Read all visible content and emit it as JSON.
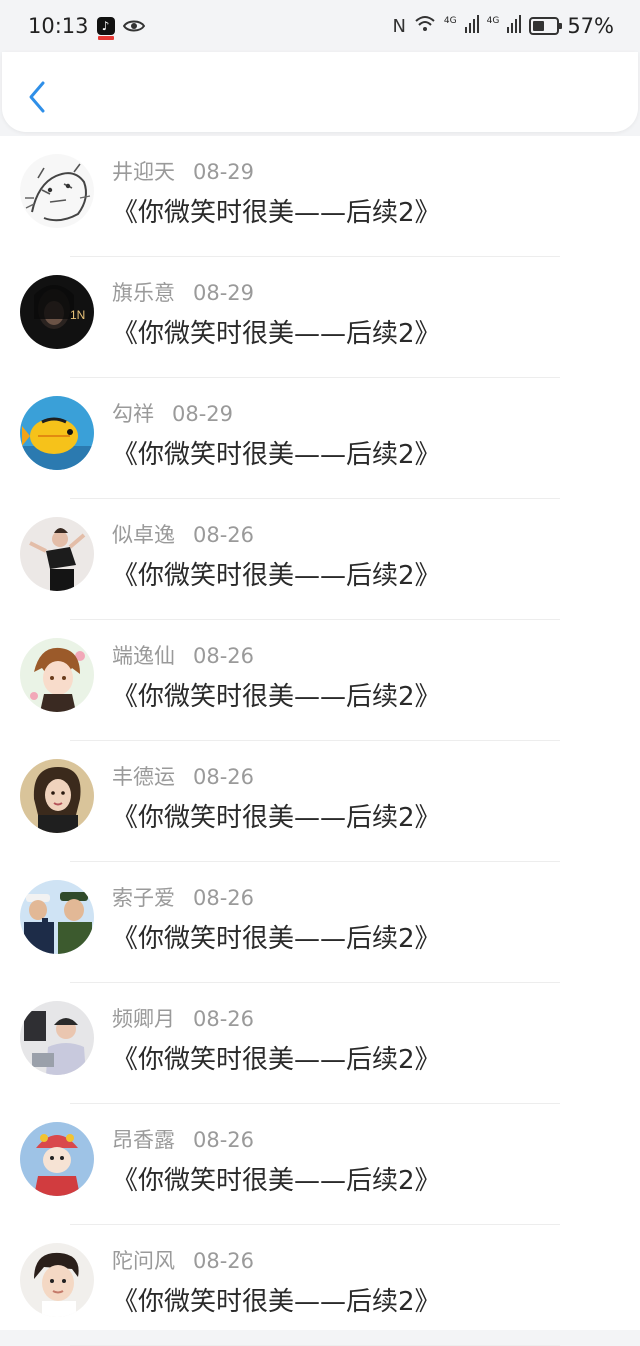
{
  "status_bar": {
    "time": "10:13",
    "nfc": "N",
    "network_a": "4G",
    "network_b": "4G",
    "battery_percent": "57%",
    "battery_level": 0.57
  },
  "colors": {
    "accent": "#2f8fe8",
    "meta_text": "#9a9a9a",
    "title_text": "#2a2a2a"
  },
  "nav": {
    "back_icon": "chevron-left-icon"
  },
  "comments": [
    {
      "name": "井迎天",
      "date": "08-29",
      "title": "《你微笑时很美——后续2》"
    },
    {
      "name": "旗乐意",
      "date": "08-29",
      "title": "《你微笑时很美——后续2》"
    },
    {
      "name": "勾祥",
      "date": "08-29",
      "title": "《你微笑时很美——后续2》"
    },
    {
      "name": "似卓逸",
      "date": "08-26",
      "title": "《你微笑时很美——后续2》"
    },
    {
      "name": "端逸仙",
      "date": "08-26",
      "title": "《你微笑时很美——后续2》"
    },
    {
      "name": "丰德运",
      "date": "08-26",
      "title": "《你微笑时很美——后续2》"
    },
    {
      "name": "索子爱",
      "date": "08-26",
      "title": "《你微笑时很美——后续2》"
    },
    {
      "name": "频卿月",
      "date": "08-26",
      "title": "《你微笑时很美——后续2》"
    },
    {
      "name": "昂香露",
      "date": "08-26",
      "title": "《你微笑时很美——后续2》"
    },
    {
      "name": "陀问风",
      "date": "08-26",
      "title": "《你微笑时很美——后续2》"
    }
  ]
}
